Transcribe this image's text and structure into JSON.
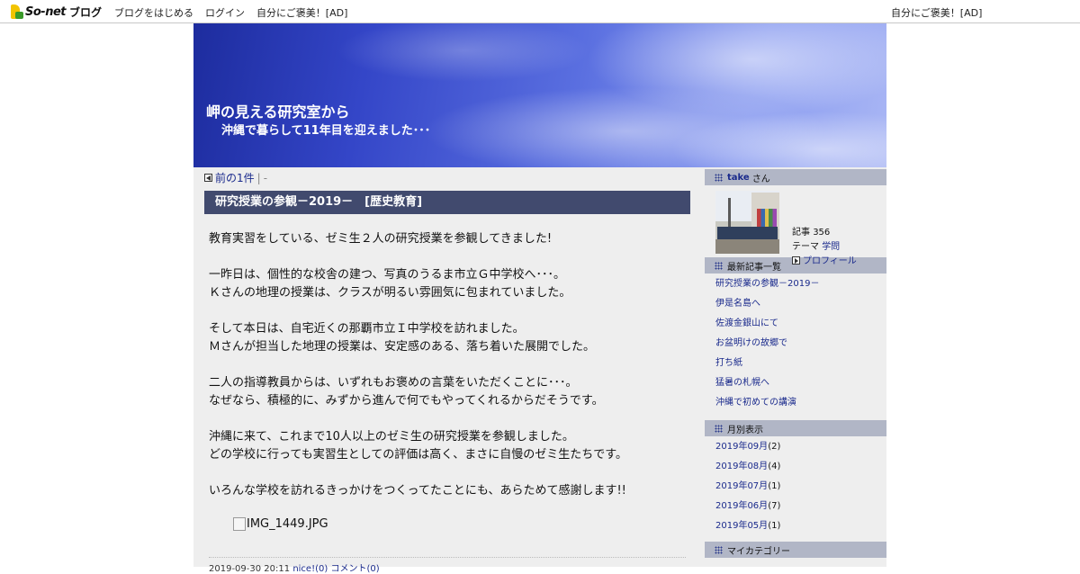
{
  "topbar": {
    "brand": "So-net",
    "blog": "ブログ",
    "nav": [
      "ブログをはじめる",
      "ログイン",
      "自分にご褒美！[AD]"
    ],
    "ad_right": "自分にご褒美！[AD]"
  },
  "banner": {
    "title": "岬の見える研究室から",
    "subtitle": "沖縄で暮らして11年目を迎えました･･･"
  },
  "pager": {
    "prev": "前の1件",
    "sep": "|",
    "next": "-"
  },
  "entry": {
    "title": "研究授業の参観－2019－　[歴史教育]",
    "paragraphs": [
      "教育実習をしている、ゼミ生２人の研究授業を参観してきました!",
      "",
      "一昨日は、個性的な校舎の建つ、写真のうるま市立Ｇ中学校へ･･･。",
      "Ｋさんの地理の授業は、クラスが明るい雰囲気に包まれていました。",
      "",
      "そして本日は、自宅近くの那覇市立Ｉ中学校を訪れました。",
      "Ｍさんが担当した地理の授業は、安定感のある、落ち着いた展開でした。",
      "",
      "二人の指導教員からは、いずれもお褒めの言葉をいただくことに･･･。",
      "なぜなら、積極的に、みずから進んで何でもやってくれるからだそうです。",
      "",
      "沖縄に来て、これまで10人以上のゼミ生の研究授業を参観しました。",
      "どの学校に行っても実習生としての評価は高く、まさに自慢のゼミ生たちです。",
      "",
      "いろんな学校を訪れるきっかけをつくってたことにも、あらためて感謝します!!"
    ],
    "image_alt": "IMG_1449.JPG",
    "footer": {
      "date": "2019-09-30 20:11",
      "nice": "nice!(0)",
      "comment": "コメント(0)"
    }
  },
  "sidebar": {
    "profile": {
      "name": "take",
      "suffix": "さん",
      "articles_label": "記事",
      "articles_count": "356",
      "theme_label": "テーマ",
      "theme_value": "学問",
      "profile_link": "プロフィール"
    },
    "recent": {
      "heading": "最新記事一覧",
      "items": [
        "研究授業の参観－2019－",
        "伊是名島へ",
        "佐渡金銀山にて",
        "お盆明けの故郷で",
        "打ち紙",
        "猛暑の札幌へ",
        "沖縄で初めての講演"
      ]
    },
    "archive": {
      "heading": "月別表示",
      "items": [
        {
          "month": "2019年09月",
          "count": "(2)"
        },
        {
          "month": "2019年08月",
          "count": "(4)"
        },
        {
          "month": "2019年07月",
          "count": "(1)"
        },
        {
          "month": "2019年06月",
          "count": "(7)"
        },
        {
          "month": "2019年05月",
          "count": "(1)"
        }
      ]
    },
    "category": {
      "heading": "マイカテゴリー"
    }
  }
}
